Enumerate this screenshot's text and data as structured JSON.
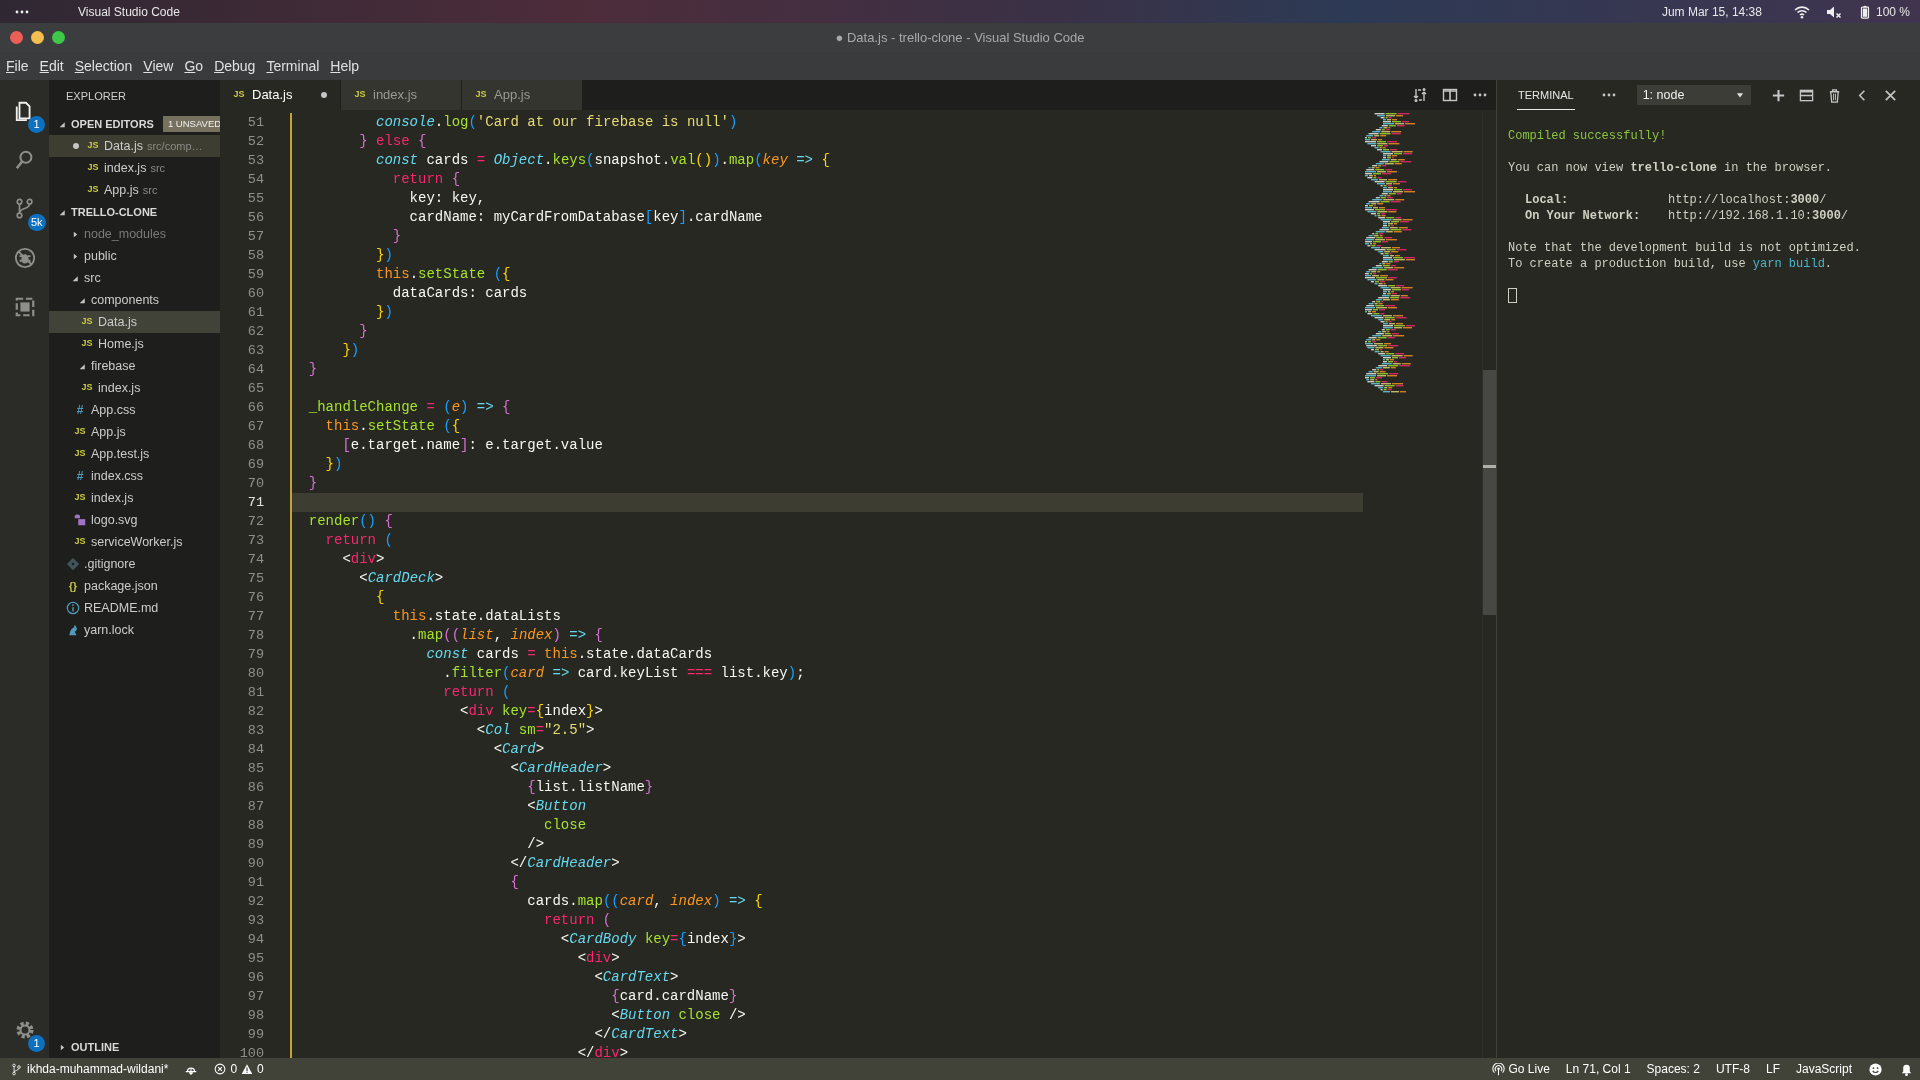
{
  "system_bar": {
    "app": "Visual Studio Code",
    "clock": "Jum Mar 15, 14:38",
    "battery": "100 %"
  },
  "window": {
    "title": "● Data.js - trello-clone - Visual Studio Code"
  },
  "menu": [
    "File",
    "Edit",
    "Selection",
    "View",
    "Go",
    "Debug",
    "Terminal",
    "Help"
  ],
  "activity_bar": {
    "items": [
      {
        "kind": "explorer",
        "selected": true,
        "badge": "1"
      },
      {
        "kind": "search",
        "selected": false
      },
      {
        "kind": "source-control",
        "selected": false,
        "badge": "5k"
      },
      {
        "kind": "debug",
        "selected": false
      },
      {
        "kind": "extensions",
        "selected": false
      }
    ],
    "settings_badge": "1"
  },
  "sidebar": {
    "title": "EXPLORER",
    "open_editors": {
      "title": "OPEN EDITORS",
      "expanded": true,
      "badge": "1 UNSAVED",
      "items": [
        {
          "name": "Data.js",
          "path": "src/comp…",
          "kind": "js",
          "icon": "JS",
          "dirty": true,
          "selected": true
        },
        {
          "name": "index.js",
          "path": "src",
          "kind": "js",
          "icon": "JS",
          "dirty": false,
          "selected": false
        },
        {
          "name": "App.js",
          "path": "src",
          "kind": "js",
          "icon": "JS",
          "dirty": false,
          "selected": false
        }
      ]
    },
    "project": {
      "title": "TRELLO-CLONE",
      "expanded": true,
      "children": [
        {
          "name": "node_modules",
          "kind": "folder",
          "expanded": false,
          "ignored": true,
          "selected": false
        },
        {
          "name": "public",
          "kind": "folder",
          "expanded": false,
          "ignored": false,
          "selected": false
        },
        {
          "name": "src",
          "kind": "folder",
          "expanded": true,
          "ignored": false,
          "selected": false,
          "children": [
            {
              "name": "components",
              "kind": "folder",
              "expanded": true,
              "ignored": false,
              "selected": false,
              "children": [
                {
                  "name": "Data.js",
                  "kind": "js",
                  "icon": "JS",
                  "ignored": false,
                  "selected": true
                },
                {
                  "name": "Home.js",
                  "kind": "js",
                  "icon": "JS",
                  "ignored": false,
                  "selected": false
                }
              ]
            },
            {
              "name": "firebase",
              "kind": "folder",
              "expanded": true,
              "ignored": false,
              "selected": false,
              "children": [
                {
                  "name": "index.js",
                  "kind": "js",
                  "icon": "JS",
                  "ignored": false,
                  "selected": false
                }
              ]
            },
            {
              "name": "App.css",
              "kind": "css",
              "icon": "#",
              "ignored": false,
              "selected": false
            },
            {
              "name": "App.js",
              "kind": "js",
              "icon": "JS",
              "ignored": false,
              "selected": false
            },
            {
              "name": "App.test.js",
              "kind": "js",
              "icon": "JS",
              "ignored": false,
              "selected": false
            },
            {
              "name": "index.css",
              "kind": "css",
              "icon": "#",
              "ignored": false,
              "selected": false
            },
            {
              "name": "index.js",
              "kind": "js",
              "icon": "JS",
              "ignored": false,
              "selected": false
            },
            {
              "name": "logo.svg",
              "kind": "image",
              "ignored": false,
              "selected": false
            },
            {
              "name": "serviceWorker.js",
              "kind": "js",
              "icon": "JS",
              "ignored": false,
              "selected": false
            }
          ]
        },
        {
          "name": ".gitignore",
          "kind": "git",
          "ignored": false,
          "selected": false
        },
        {
          "name": "package.json",
          "kind": "json",
          "icon": "{}",
          "ignored": false,
          "selected": false
        },
        {
          "name": "README.md",
          "kind": "info",
          "ignored": false,
          "selected": false
        },
        {
          "name": "yarn.lock",
          "kind": "yarn",
          "ignored": false,
          "selected": false
        }
      ]
    },
    "outline": {
      "title": "OUTLINE",
      "expanded": false
    }
  },
  "editor": {
    "tabs": [
      {
        "label": "Data.js",
        "icon": "JS",
        "selected": true,
        "dirty": true
      },
      {
        "label": "index.js",
        "icon": "JS",
        "selected": false,
        "dirty": false
      },
      {
        "label": "App.js",
        "icon": "JS",
        "selected": false,
        "dirty": false
      }
    ],
    "lines": [
      {
        "n": "51",
        "current": false,
        "tokens": [
          {
            "kind": "italic",
            "text": "          console"
          },
          {
            "kind": "plain",
            "text": "."
          },
          {
            "kind": "fn",
            "text": "log"
          },
          {
            "kind": "b3",
            "text": "("
          },
          {
            "kind": "str",
            "text": "'Card at our firebase is null'"
          },
          {
            "kind": "b3",
            "text": ")"
          }
        ]
      },
      {
        "n": "52",
        "current": false,
        "tokens": [
          {
            "kind": "b2",
            "text": "        } "
          },
          {
            "kind": "kw",
            "text": "else "
          },
          {
            "kind": "b2",
            "text": "{"
          }
        ]
      },
      {
        "n": "53",
        "current": false,
        "tokens": [
          {
            "kind": "italic",
            "text": "          const "
          },
          {
            "kind": "plain",
            "text": "cards "
          },
          {
            "kind": "kw",
            "text": "= "
          },
          {
            "kind": "italic",
            "text": "Object"
          },
          {
            "kind": "plain",
            "text": "."
          },
          {
            "kind": "fn",
            "text": "keys"
          },
          {
            "kind": "b3",
            "text": "("
          },
          {
            "kind": "plain",
            "text": "snapshot."
          },
          {
            "kind": "fn",
            "text": "val"
          },
          {
            "kind": "b1",
            "text": "()"
          },
          {
            "kind": "b3",
            "text": ")"
          },
          {
            "kind": "plain",
            "text": "."
          },
          {
            "kind": "fn",
            "text": "map"
          },
          {
            "kind": "b3",
            "text": "("
          },
          {
            "kind": "param",
            "text": "key "
          },
          {
            "kind": "arrow",
            "text": "=> "
          },
          {
            "kind": "b1",
            "text": "{"
          }
        ]
      },
      {
        "n": "54",
        "current": false,
        "tokens": [
          {
            "kind": "kw",
            "text": "            return "
          },
          {
            "kind": "b2",
            "text": "{"
          }
        ]
      },
      {
        "n": "55",
        "current": false,
        "tokens": [
          {
            "kind": "plain",
            "text": "              key: key,"
          }
        ]
      },
      {
        "n": "56",
        "current": false,
        "tokens": [
          {
            "kind": "plain",
            "text": "              cardName: myCardFromDatabase"
          },
          {
            "kind": "b3",
            "text": "["
          },
          {
            "kind": "plain",
            "text": "key"
          },
          {
            "kind": "b3",
            "text": "]"
          },
          {
            "kind": "plain",
            "text": ".cardName"
          }
        ]
      },
      {
        "n": "57",
        "current": false,
        "tokens": [
          {
            "kind": "b2",
            "text": "            }"
          }
        ]
      },
      {
        "n": "58",
        "current": false,
        "tokens": [
          {
            "kind": "b1",
            "text": "          }"
          },
          {
            "kind": "b3",
            "text": ")"
          }
        ]
      },
      {
        "n": "59",
        "current": false,
        "tokens": [
          {
            "kind": "this",
            "text": "          this"
          },
          {
            "kind": "plain",
            "text": "."
          },
          {
            "kind": "fn",
            "text": "setState "
          },
          {
            "kind": "b3",
            "text": "("
          },
          {
            "kind": "b1",
            "text": "{"
          }
        ]
      },
      {
        "n": "60",
        "current": false,
        "tokens": [
          {
            "kind": "plain",
            "text": "            dataCards: cards"
          }
        ]
      },
      {
        "n": "61",
        "current": false,
        "tokens": [
          {
            "kind": "b1",
            "text": "          }"
          },
          {
            "kind": "b3",
            "text": ")"
          }
        ]
      },
      {
        "n": "62",
        "current": false,
        "tokens": [
          {
            "kind": "b2",
            "text": "        }"
          }
        ]
      },
      {
        "n": "63",
        "current": false,
        "tokens": [
          {
            "kind": "b1",
            "text": "      }"
          },
          {
            "kind": "b3",
            "text": ")"
          }
        ]
      },
      {
        "n": "64",
        "current": false,
        "tokens": [
          {
            "kind": "b2",
            "text": "  }"
          }
        ]
      },
      {
        "n": "65",
        "current": false
      },
      {
        "n": "66",
        "current": false,
        "tokens": [
          {
            "kind": "fn",
            "text": "  _handleChange "
          },
          {
            "kind": "kw",
            "text": "= "
          },
          {
            "kind": "b3",
            "text": "("
          },
          {
            "kind": "param",
            "text": "e"
          },
          {
            "kind": "b3",
            "text": ") "
          },
          {
            "kind": "arrow",
            "text": "=> "
          },
          {
            "kind": "b2",
            "text": "{"
          }
        ]
      },
      {
        "n": "67",
        "current": false,
        "tokens": [
          {
            "kind": "this",
            "text": "    this"
          },
          {
            "kind": "plain",
            "text": "."
          },
          {
            "kind": "fn",
            "text": "setState "
          },
          {
            "kind": "b3",
            "text": "("
          },
          {
            "kind": "b1",
            "text": "{"
          }
        ]
      },
      {
        "n": "68",
        "current": false,
        "tokens": [
          {
            "kind": "b2",
            "text": "      ["
          },
          {
            "kind": "plain",
            "text": "e.target.name"
          },
          {
            "kind": "b2",
            "text": "]"
          },
          {
            "kind": "plain",
            "text": ": e.target.value"
          }
        ]
      },
      {
        "n": "69",
        "current": false,
        "tokens": [
          {
            "kind": "b1",
            "text": "    }"
          },
          {
            "kind": "b3",
            "text": ")"
          }
        ]
      },
      {
        "n": "70",
        "current": false,
        "tokens": [
          {
            "kind": "b2",
            "text": "  }"
          }
        ]
      },
      {
        "n": "71",
        "current": true
      },
      {
        "n": "72",
        "current": false,
        "tokens": [
          {
            "kind": "fn",
            "text": "  render"
          },
          {
            "kind": "b3",
            "text": "() "
          },
          {
            "kind": "b2",
            "text": "{"
          }
        ]
      },
      {
        "n": "73",
        "current": false,
        "tokens": [
          {
            "kind": "kw",
            "text": "    return "
          },
          {
            "kind": "b3",
            "text": "("
          }
        ]
      },
      {
        "n": "74",
        "current": false,
        "tokens": [
          {
            "kind": "plain",
            "text": "      <"
          },
          {
            "kind": "tag",
            "text": "div"
          },
          {
            "kind": "plain",
            "text": ">"
          }
        ]
      },
      {
        "n": "75",
        "current": false,
        "tokens": [
          {
            "kind": "plain",
            "text": "        <"
          },
          {
            "kind": "comp",
            "text": "CardDeck"
          },
          {
            "kind": "plain",
            "text": ">"
          }
        ]
      },
      {
        "n": "76",
        "current": false,
        "tokens": [
          {
            "kind": "b1",
            "text": "          {"
          }
        ]
      },
      {
        "n": "77",
        "current": false,
        "tokens": [
          {
            "kind": "this",
            "text": "            this"
          },
          {
            "kind": "plain",
            "text": ".state.dataLists"
          }
        ]
      },
      {
        "n": "78",
        "current": false,
        "tokens": [
          {
            "kind": "plain",
            "text": "              ."
          },
          {
            "kind": "fn",
            "text": "map"
          },
          {
            "kind": "b2",
            "text": "(("
          },
          {
            "kind": "param",
            "text": "list"
          },
          {
            "kind": "plain",
            "text": ", "
          },
          {
            "kind": "param",
            "text": "index"
          },
          {
            "kind": "b2",
            "text": ") "
          },
          {
            "kind": "arrow",
            "text": "=> "
          },
          {
            "kind": "b2",
            "text": "{"
          }
        ]
      },
      {
        "n": "79",
        "current": false,
        "tokens": [
          {
            "kind": "italic",
            "text": "                const "
          },
          {
            "kind": "plain",
            "text": "cards "
          },
          {
            "kind": "kw",
            "text": "= "
          },
          {
            "kind": "this",
            "text": "this"
          },
          {
            "kind": "plain",
            "text": ".state.dataCards"
          }
        ]
      },
      {
        "n": "80",
        "current": false,
        "tokens": [
          {
            "kind": "plain",
            "text": "                  ."
          },
          {
            "kind": "fn",
            "text": "filter"
          },
          {
            "kind": "b3",
            "text": "("
          },
          {
            "kind": "param",
            "text": "card "
          },
          {
            "kind": "arrow",
            "text": "=> "
          },
          {
            "kind": "plain",
            "text": "card.keyList "
          },
          {
            "kind": "kw",
            "text": "=== "
          },
          {
            "kind": "plain",
            "text": "list.key"
          },
          {
            "kind": "b3",
            "text": ")"
          },
          {
            "kind": "plain",
            "text": ";"
          }
        ]
      },
      {
        "n": "81",
        "current": false,
        "tokens": [
          {
            "kind": "kw",
            "text": "                  return "
          },
          {
            "kind": "b3",
            "text": "("
          }
        ]
      },
      {
        "n": "82",
        "current": false,
        "tokens": [
          {
            "kind": "plain",
            "text": "                    <"
          },
          {
            "kind": "tag",
            "text": "div "
          },
          {
            "kind": "attr",
            "text": "key"
          },
          {
            "kind": "kw",
            "text": "="
          },
          {
            "kind": "b1",
            "text": "{"
          },
          {
            "kind": "plain",
            "text": "index"
          },
          {
            "kind": "b1",
            "text": "}"
          },
          {
            "kind": "plain",
            "text": ">"
          }
        ]
      },
      {
        "n": "83",
        "current": false,
        "tokens": [
          {
            "kind": "plain",
            "text": "                      <"
          },
          {
            "kind": "comp",
            "text": "Col "
          },
          {
            "kind": "attr",
            "text": "sm"
          },
          {
            "kind": "kw",
            "text": "="
          },
          {
            "kind": "str",
            "text": "\"2.5\""
          },
          {
            "kind": "plain",
            "text": ">"
          }
        ]
      },
      {
        "n": "84",
        "current": false,
        "tokens": [
          {
            "kind": "plain",
            "text": "                        <"
          },
          {
            "kind": "comp",
            "text": "Card"
          },
          {
            "kind": "plain",
            "text": ">"
          }
        ]
      },
      {
        "n": "85",
        "current": false,
        "tokens": [
          {
            "kind": "plain",
            "text": "                          <"
          },
          {
            "kind": "comp",
            "text": "CardHeader"
          },
          {
            "kind": "plain",
            "text": ">"
          }
        ]
      },
      {
        "n": "86",
        "current": false,
        "tokens": [
          {
            "kind": "b2",
            "text": "                            {"
          },
          {
            "kind": "plain",
            "text": "list.listName"
          },
          {
            "kind": "b2",
            "text": "}"
          }
        ]
      },
      {
        "n": "87",
        "current": false,
        "tokens": [
          {
            "kind": "plain",
            "text": "                            <"
          },
          {
            "kind": "comp",
            "text": "Button"
          }
        ]
      },
      {
        "n": "88",
        "current": false,
        "tokens": [
          {
            "kind": "attr",
            "text": "                              close"
          }
        ]
      },
      {
        "n": "89",
        "current": false,
        "tokens": [
          {
            "kind": "plain",
            "text": "                            />"
          }
        ]
      },
      {
        "n": "90",
        "current": false,
        "tokens": [
          {
            "kind": "plain",
            "text": "                          </"
          },
          {
            "kind": "comp",
            "text": "CardHeader"
          },
          {
            "kind": "plain",
            "text": ">"
          }
        ]
      },
      {
        "n": "91",
        "current": false,
        "tokens": [
          {
            "kind": "b2",
            "text": "                          {"
          }
        ]
      },
      {
        "n": "92",
        "current": false,
        "tokens": [
          {
            "kind": "plain",
            "text": "                            cards."
          },
          {
            "kind": "fn",
            "text": "map"
          },
          {
            "kind": "b3",
            "text": "(("
          },
          {
            "kind": "param",
            "text": "card"
          },
          {
            "kind": "plain",
            "text": ", "
          },
          {
            "kind": "param",
            "text": "index"
          },
          {
            "kind": "b3",
            "text": ") "
          },
          {
            "kind": "arrow",
            "text": "=> "
          },
          {
            "kind": "b1",
            "text": "{"
          }
        ]
      },
      {
        "n": "93",
        "current": false,
        "tokens": [
          {
            "kind": "kw",
            "text": "                              return "
          },
          {
            "kind": "b2",
            "text": "("
          }
        ]
      },
      {
        "n": "94",
        "current": false,
        "tokens": [
          {
            "kind": "plain",
            "text": "                                <"
          },
          {
            "kind": "comp",
            "text": "CardBody "
          },
          {
            "kind": "attr",
            "text": "key"
          },
          {
            "kind": "kw",
            "text": "="
          },
          {
            "kind": "b3",
            "text": "{"
          },
          {
            "kind": "plain",
            "text": "index"
          },
          {
            "kind": "b3",
            "text": "}"
          },
          {
            "kind": "plain",
            "text": ">"
          }
        ]
      },
      {
        "n": "95",
        "current": false,
        "tokens": [
          {
            "kind": "plain",
            "text": "                                  <"
          },
          {
            "kind": "tag",
            "text": "div"
          },
          {
            "kind": "plain",
            "text": ">"
          }
        ]
      },
      {
        "n": "96",
        "current": false,
        "tokens": [
          {
            "kind": "plain",
            "text": "                                    <"
          },
          {
            "kind": "comp",
            "text": "CardText"
          },
          {
            "kind": "plain",
            "text": ">"
          }
        ]
      },
      {
        "n": "97",
        "current": false,
        "tokens": [
          {
            "kind": "b2",
            "text": "                                      {"
          },
          {
            "kind": "plain",
            "text": "card.cardName"
          },
          {
            "kind": "b2",
            "text": "}"
          }
        ]
      },
      {
        "n": "98",
        "current": false,
        "tokens": [
          {
            "kind": "plain",
            "text": "                                      <"
          },
          {
            "kind": "comp",
            "text": "Button "
          },
          {
            "kind": "attr",
            "text": "close "
          },
          {
            "kind": "plain",
            "text": "/>"
          }
        ]
      },
      {
        "n": "99",
        "current": false,
        "tokens": [
          {
            "kind": "plain",
            "text": "                                    </"
          },
          {
            "kind": "comp",
            "text": "CardText"
          },
          {
            "kind": "plain",
            "text": ">"
          }
        ]
      },
      {
        "n": "100",
        "current": false,
        "tokens": [
          {
            "kind": "plain",
            "text": "                                  </"
          },
          {
            "kind": "tag",
            "text": "div"
          },
          {
            "kind": "plain",
            "text": ">"
          }
        ]
      }
    ]
  },
  "terminal": {
    "tab": "TERMINAL",
    "selector": "1: node",
    "cursor": true,
    "output": [
      {
        "kind": "success",
        "text": "Compiled successfully!"
      },
      {
        "kind": "info",
        "text": "You can now view **trello-clone** in the browser."
      },
      {
        "kind": "address",
        "label": "Local:",
        "url": "http://localhost:**3000**/"
      },
      {
        "kind": "address",
        "label": "On Your Network:",
        "url": "http://192.168.1.10:**3000**/"
      },
      {
        "kind": "note",
        "text": "Note that the development build is not optimized."
      },
      {
        "kind": "note",
        "text": "To create a production build, use ",
        "command": "yarn build",
        "after": "."
      }
    ]
  },
  "status_bar": {
    "branch": "ikhda-muhammad-wildani*",
    "errors": "0",
    "warnings": "0",
    "right": [
      {
        "kind": "live",
        "text": "Go Live"
      },
      {
        "kind": "plain",
        "text": "Ln 71, Col 1"
      },
      {
        "kind": "plain",
        "text": "Spaces: 2"
      },
      {
        "kind": "plain",
        "text": "UTF-8"
      },
      {
        "kind": "plain",
        "text": "LF"
      },
      {
        "kind": "plain",
        "text": "JavaScript"
      }
    ]
  }
}
